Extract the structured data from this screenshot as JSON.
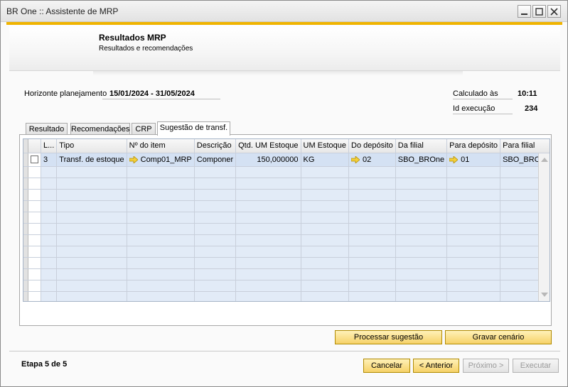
{
  "window": {
    "title": "BR One :: Assistente de MRP"
  },
  "header": {
    "title": "Resultados MRP",
    "subtitle": "Resultados e recomendações"
  },
  "info": {
    "horizonte_label": "Horizonte planejamento",
    "horizonte_value": "15/01/2024 - 31/05/2024",
    "calculado_label": "Calculado às",
    "calculado_value": "10:11",
    "id_label": "Id execução",
    "id_value": "234"
  },
  "tabs": [
    {
      "label": "Resultado"
    },
    {
      "label": "Recomendações"
    },
    {
      "label": "CRP"
    },
    {
      "label": "Sugestão de transf.",
      "active": true
    }
  ],
  "table": {
    "columns": [
      "L...",
      "Tipo",
      "Nº do item",
      "Descrição",
      "Qtd. UM Estoque",
      "UM Estoque",
      "Do depósito",
      "Da filial",
      "Para depósito",
      "Para filial"
    ],
    "rows": [
      {
        "checked": false,
        "line": "3",
        "tipo": "Transf. de estoque",
        "item": "Comp01_MRP",
        "descricao": "Componer",
        "qtd": "150,000000",
        "um": "KG",
        "do_deposito": "02",
        "da_filial": "SBO_BROne",
        "para_deposito": "01",
        "para_filial": "SBO_BROne"
      }
    ]
  },
  "actions": {
    "processar": "Processar sugestão",
    "gravar": "Gravar cenário"
  },
  "footer": {
    "step": "Etapa 5 de 5",
    "cancel": "Cancelar",
    "back": "< Anterior",
    "next": "Próximo >",
    "execute": "Executar"
  },
  "colors": {
    "accent": "#f0b400",
    "button_fill": "#f6d268",
    "grid_cell": "#e2ebf7"
  }
}
